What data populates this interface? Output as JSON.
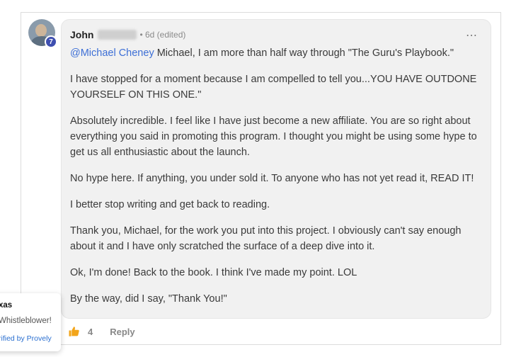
{
  "comment": {
    "author": "John",
    "meta": "• 6d (edited)",
    "level_badge": "7",
    "more_icon": "⋯",
    "mention": "@Michael Cheney",
    "paragraph_1_rest": " Michael, I am more than half way through \"The Guru's Playbook.\"",
    "paragraph_2": "I have stopped for a moment because I am compelled to tell you...YOU HAVE OUTDONE YOURSELF ON THIS ONE.\"",
    "paragraph_3": "Absolutely incredible. I feel like I have just become a new affiliate. You are so right about everything you said in promoting this program. I thought you might be using some hype to get us all enthusiastic about the launch.",
    "paragraph_4": "No hype here. If anything, you under sold it. To anyone who has not yet read it, READ IT!",
    "paragraph_5": "I better stop writing and get back to reading.",
    "paragraph_6": "Thank you, Michael, for the work you put into this project. I obviously can't say enough about it and I have only scratched the surface of a deep dive into it.",
    "paragraph_7": "Ok, I'm done! Back to the book. I think I've made my point. LOL",
    "paragraph_8": "By the way, did I say, \"Thank You!\""
  },
  "actions": {
    "like_count": "4",
    "reply_label": "Reply"
  },
  "toast": {
    "line1": "xas",
    "line2": "Whistleblower!",
    "line3": "rified by Provely"
  },
  "colors": {
    "mention": "#3d6fd6",
    "badge": "#3e4fb0",
    "verified": "#2a6fd0"
  },
  "icons": {
    "like": "thumbs-up-icon",
    "more": "more-options-icon"
  }
}
